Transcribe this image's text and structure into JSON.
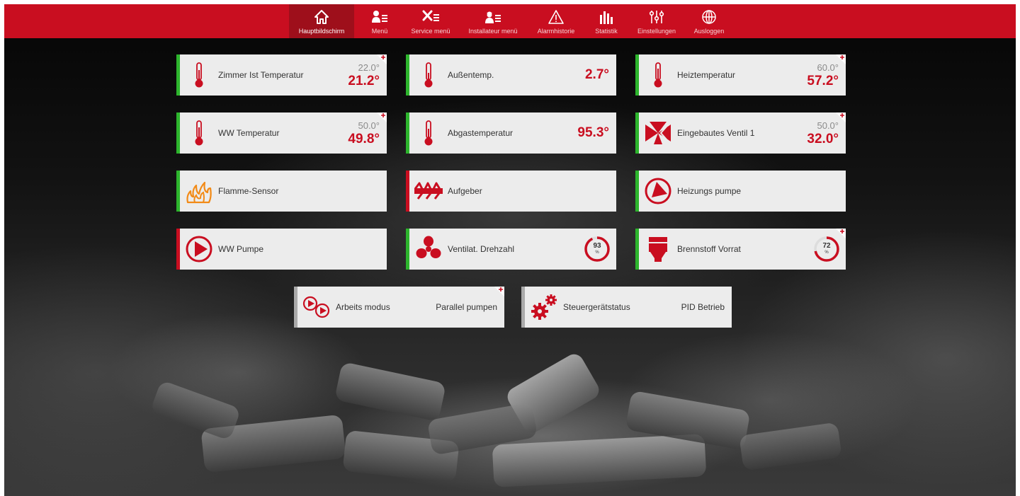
{
  "nav": {
    "items": [
      {
        "label": "Hauptbildschirm",
        "icon": "home-icon",
        "active": true
      },
      {
        "label": "Menü",
        "icon": "user-menu-icon"
      },
      {
        "label": "Service menü",
        "icon": "service-tools-icon"
      },
      {
        "label": "Installateur menü",
        "icon": "installer-icon"
      },
      {
        "label": "Alarmhistorie",
        "icon": "alarm-warning-icon"
      },
      {
        "label": "Statistik",
        "icon": "statistics-bars-icon"
      },
      {
        "label": "Einstellungen",
        "icon": "sliders-icon"
      },
      {
        "label": "Ausloggen",
        "icon": "globe-icon"
      }
    ]
  },
  "tiles": {
    "zimmer": {
      "label": "Zimmer Ist Temperatur",
      "set": "22.0°",
      "current": "21.2°",
      "icon": "thermometer-icon"
    },
    "aussen": {
      "label": "Außentemp.",
      "current": "2.7°",
      "icon": "thermometer-icon"
    },
    "heiz": {
      "label": "Heiztemperatur",
      "set": "60.0°",
      "current": "57.2°",
      "icon": "thermometer-icon"
    },
    "ww": {
      "label": "WW Temperatur",
      "set": "50.0°",
      "current": "49.8°",
      "icon": "thermometer-icon"
    },
    "abgas": {
      "label": "Abgastemperatur",
      "current": "95.3°",
      "icon": "thermometer-icon"
    },
    "ventil": {
      "label": "Eingebautes Ventil 1",
      "set": "50.0°",
      "current": "32.0°",
      "icon": "valve-icon"
    },
    "flamme": {
      "label": "Flamme-Sensor",
      "icon": "flame-icon"
    },
    "aufgeber": {
      "label": "Aufgeber",
      "icon": "feeder-icon"
    },
    "heizpumpe": {
      "label": "Heizungs pumpe",
      "icon": "pump-icon"
    },
    "wwpumpe": {
      "label": "WW Pumpe",
      "icon": "pump-icon"
    },
    "ventilator": {
      "label": "Ventilat. Drehzahl",
      "value": "93",
      "unit": "%",
      "icon": "fan-icon"
    },
    "brennstoff": {
      "label": "Brennstoff Vorrat",
      "value": "72",
      "unit": "%",
      "icon": "fuel-hopper-icon"
    },
    "arbeits": {
      "label": "Arbeits modus",
      "value": "Parallel pumpen",
      "icon": "double-pump-icon"
    },
    "steuer": {
      "label": "Steuergerätstatus",
      "value": "PID Betrieb",
      "icon": "gears-icon"
    }
  },
  "gauges": {
    "ventilator_percent": 93,
    "brennstoff_percent": 72
  },
  "colors": {
    "brand_red": "#c90e20",
    "active_tab": "#9e0f1b",
    "status_green": "#2db52d",
    "tile_bg": "#ececec",
    "flame_orange": "#f28a16"
  }
}
